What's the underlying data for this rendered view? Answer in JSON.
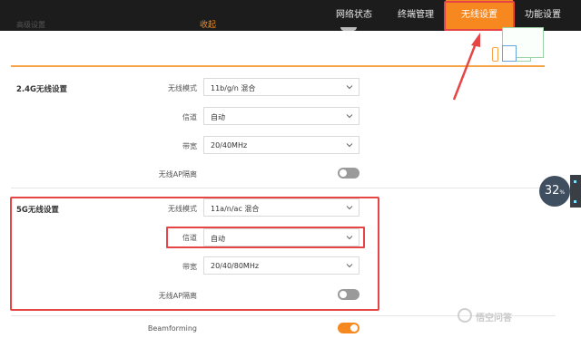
{
  "nav": {
    "items": [
      {
        "label": "网络状态",
        "active": false
      },
      {
        "label": "终端管理",
        "active": false
      },
      {
        "label": "无线设置",
        "active": true
      },
      {
        "label": "功能设置",
        "active": false
      }
    ]
  },
  "advanced": {
    "label": "高级设置",
    "collapse_link": "收起"
  },
  "wifi24": {
    "section_title": "2.4G无线设置",
    "mode_label": "无线模式",
    "mode_value": "11b/g/n 混合",
    "channel_label": "信道",
    "channel_value": "自动",
    "bandwidth_label": "带宽",
    "bandwidth_value": "20/40MHz",
    "ap_isolation_label": "无线AP隔离",
    "ap_isolation_on": false
  },
  "wifi5": {
    "section_title": "5G无线设置",
    "mode_label": "无线模式",
    "mode_value": "11a/n/ac 混合",
    "channel_label": "信道",
    "channel_value": "自动",
    "bandwidth_label": "带宽",
    "bandwidth_value": "20/40/80MHz",
    "ap_isolation_label": "无线AP隔离",
    "ap_isolation_on": false
  },
  "beamforming": {
    "label": "Beamforming",
    "on": true
  },
  "badge": {
    "value": "32",
    "unit": "%"
  },
  "watermark": {
    "text": "悟空问答"
  },
  "colors": {
    "accent": "#f7881f",
    "highlight_box": "#e64545",
    "topbar": "#1c1c1c"
  }
}
